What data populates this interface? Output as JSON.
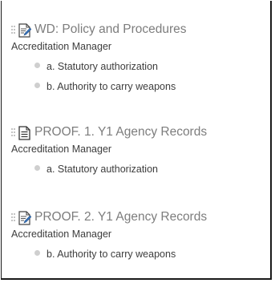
{
  "documents": [
    {
      "icon": "doc-edit-icon",
      "title": "WD: Policy and Procedures",
      "subtitle": "Accreditation Manager",
      "items": [
        {
          "label": "a. Statutory authorization"
        },
        {
          "label": "b. Authority to carry weapons"
        }
      ]
    },
    {
      "icon": "doc-text-icon",
      "title": "PROOF. 1. Y1 Agency Records",
      "subtitle": "Accreditation Manager",
      "items": [
        {
          "label": "a. Statutory authorization"
        }
      ]
    },
    {
      "icon": "doc-edit-icon",
      "title": "PROOF. 2. Y1 Agency Records",
      "subtitle": "Accreditation Manager",
      "items": [
        {
          "label": "b. Authority to carry weapons"
        }
      ]
    }
  ]
}
